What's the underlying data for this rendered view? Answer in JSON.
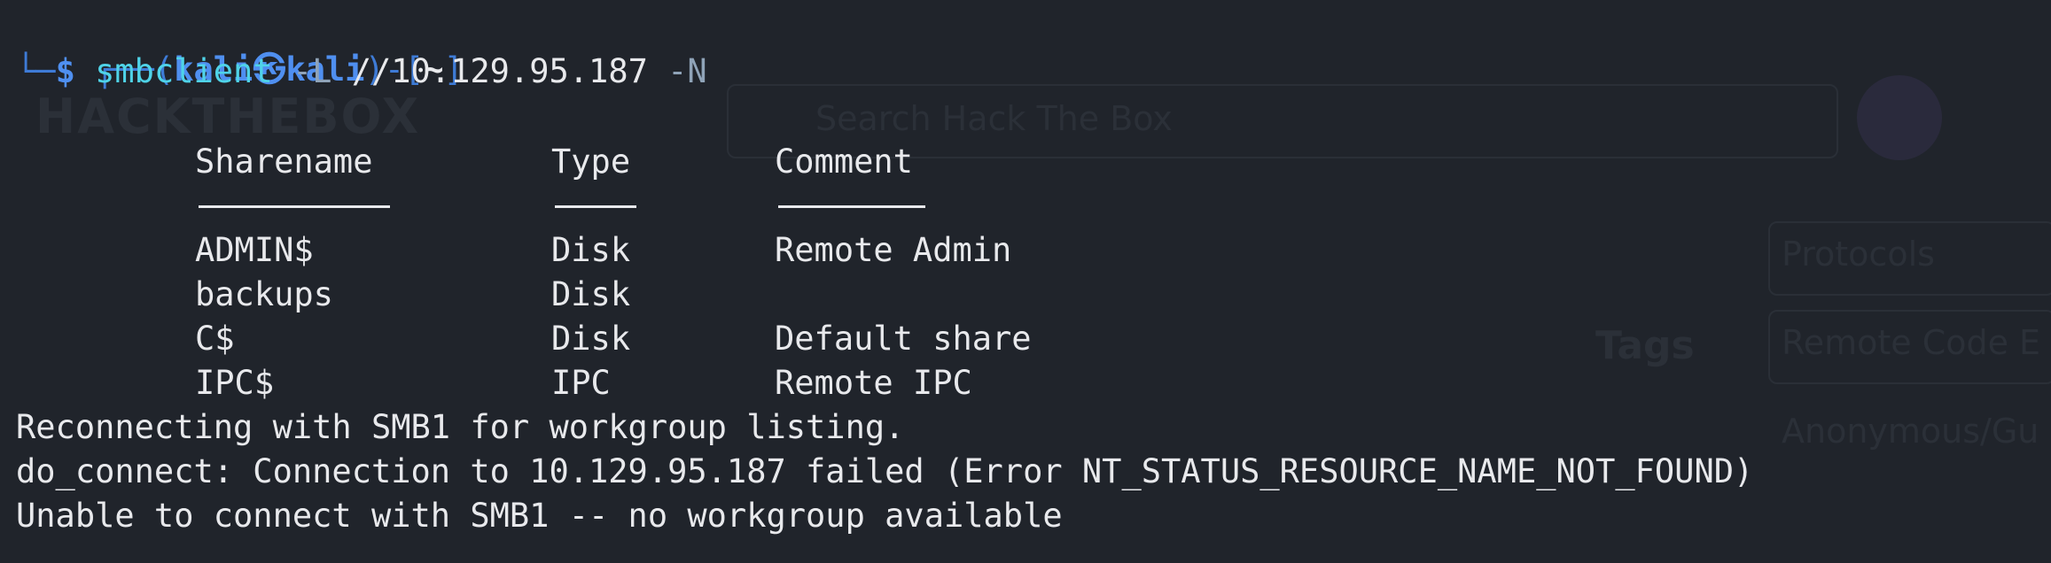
{
  "background_text": {
    "logo": "HACKTHEBOX",
    "search_placeholder": "Search Hack The Box",
    "protocols": "Protocols",
    "tags": "Tags",
    "rce": "Remote Code E",
    "anon": "Anonymous/Gu"
  },
  "prompt": {
    "top_left": "┌──(",
    "user": "kali㉿kali",
    "mid": ")-[",
    "dir": "~",
    "end": "]",
    "bottom_left": "└─",
    "dollar": "$",
    "command": "smbclient",
    "flag_list": "-L",
    "target": "//10.129.95.187",
    "flag_noauth": "-N"
  },
  "shares_table": {
    "headers": [
      "Sharename",
      "Type",
      "Comment"
    ],
    "rows": [
      {
        "name": "ADMIN$",
        "type": "Disk",
        "comment": "Remote Admin"
      },
      {
        "name": "backups",
        "type": "Disk",
        "comment": ""
      },
      {
        "name": "C$",
        "type": "Disk",
        "comment": "Default share"
      },
      {
        "name": "IPC$",
        "type": "IPC",
        "comment": "Remote IPC"
      }
    ]
  },
  "output_lines": [
    "Reconnecting with SMB1 for workgroup listing.",
    "do_connect: Connection to 10.129.95.187 failed (Error NT_STATUS_RESOURCE_NAME_NOT_FOUND)",
    "Unable to connect with SMB1 -- no workgroup available"
  ],
  "colors": {
    "background": "#20242b",
    "prompt_blue": "#4f8ff0",
    "command_cyan": "#4fd3e8",
    "text": "#e8e9ec"
  }
}
